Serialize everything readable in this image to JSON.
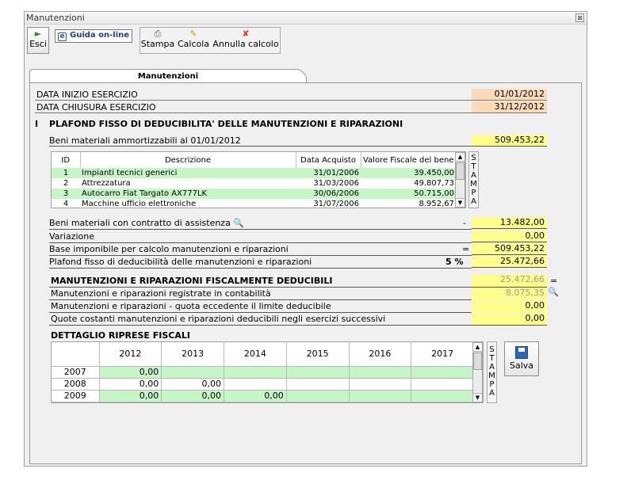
{
  "window": {
    "title": "Manutenzioni",
    "close_glyph": "⊠"
  },
  "toolbar": {
    "esci": "Esci",
    "guida": "Guida on-line",
    "stampa": "Stampa",
    "calcola": "Calcola",
    "annulla": "Annulla calcolo"
  },
  "tab": {
    "label": "Manutenzioni"
  },
  "header": {
    "data_inizio_label": "DATA INIZIO ESERCIZIO",
    "data_inizio": "01/01/2012",
    "data_chiusura_label": "DATA CHIUSURA ESERCIZIO",
    "data_chiusura": "31/12/2012"
  },
  "section1": {
    "roman": "I",
    "title": "PLAFOND FISSO DI DEDUCIBILITA' DELLE MANUTENZIONI E  RIPARAZIONI",
    "beni_label": "Beni materiali ammortizzabili al 01/01/2012",
    "beni_value": "509.453,22"
  },
  "beni_table": {
    "columns": [
      "ID",
      "Descrizione",
      "Data Acquisto",
      "Valore Fiscale del bene"
    ],
    "rows": [
      {
        "id": "1",
        "desc": "Impianti tecnici generici",
        "data": "31/01/2006",
        "valore": "39.450,00"
      },
      {
        "id": "2",
        "desc": "Attrezzatura",
        "data": "31/03/2006",
        "valore": "49.807,73"
      },
      {
        "id": "3",
        "desc": "Autocarro Fiat Targato AX777LK",
        "data": "30/06/2006",
        "valore": "50.715,00"
      },
      {
        "id": "4",
        "desc": "Macchine ufficio elettroniche",
        "data": "31/07/2006",
        "valore": "8.952,67"
      }
    ],
    "stampa_letters": [
      "S",
      "T",
      "A",
      "M",
      "P",
      "A"
    ]
  },
  "calc": {
    "assistenza_label": "Beni materiali con contratto di assistenza",
    "assistenza_op": "-",
    "assistenza_value": "13.482,00",
    "variazione_label": "Variazione",
    "variazione_value": "0,00",
    "base_label": "Base imponibile per calcolo manutenzioni e riparazioni",
    "base_op": "=",
    "base_value": "509.453,22",
    "plafond_label": "Plafond fisso di deducibilità delle manutenzioni e riparazioni",
    "plafond_pct": "5 %",
    "plafond_value": "25.472,66"
  },
  "section2": {
    "title": "MANUTENZIONI E RIPARAZIONI FISCALMENTE DEDUCIBILI",
    "title_value": "25.472,66",
    "title_op": "=",
    "registrate_label": "Manutenzioni e riparazioni registrate in contabilità",
    "registrate_value": "8.075,35",
    "eccedente_label": "Manutenzioni e riparazioni - quota eccedente il limite deducibile",
    "eccedente_value": "0,00",
    "quote_label": "Quote costanti manutenzioni e riparazioni deducibili negli esercizi successivi",
    "quote_value": "0,00"
  },
  "riprese": {
    "title": "DETTAGLIO RIPRESE FISCALI",
    "years": [
      "2012",
      "2013",
      "2014",
      "2015",
      "2016",
      "2017"
    ],
    "rows": [
      {
        "year": "2007",
        "cells": [
          "0,00",
          "",
          "",
          "",
          "",
          ""
        ]
      },
      {
        "year": "2008",
        "cells": [
          "0,00",
          "0,00",
          "",
          "",
          "",
          ""
        ]
      },
      {
        "year": "2009",
        "cells": [
          "0,00",
          "0,00",
          "0,00",
          "",
          "",
          ""
        ]
      }
    ],
    "salva": "Salva"
  },
  "colors": {
    "yellow": "#fefe8a",
    "peach": "#fadab8",
    "green": "#c6f5c6"
  }
}
